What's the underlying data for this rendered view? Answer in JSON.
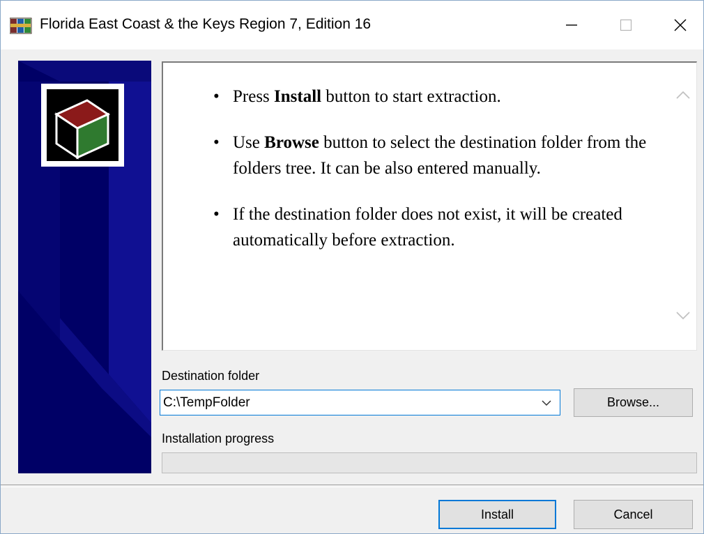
{
  "window": {
    "title": "Florida East Coast & the Keys Region 7, Edition 16",
    "app_icon": "winrar-sfx-icon"
  },
  "titlebar_buttons": {
    "minimize_icon": "minimize-icon",
    "maximize_icon": "maximize-icon",
    "close_icon": "close-icon"
  },
  "banner": {
    "background_color": "#000066",
    "logo_icon": "archive-box-icon"
  },
  "instructions": [
    {
      "pre": "Press ",
      "bold": "Install",
      "post": " button to start extraction."
    },
    {
      "pre": "Use ",
      "bold": "Browse",
      "post": " button to select the destination folder from the folders tree. It can be also entered manually."
    },
    {
      "pre": "If the destination folder does not exist, it will be created automatically before extraction.",
      "bold": "",
      "post": ""
    }
  ],
  "destination": {
    "label": "Destination folder",
    "value": "C:\\TempFolder",
    "browse_label": "Browse..."
  },
  "progress": {
    "label": "Installation progress",
    "value": 0
  },
  "buttons": {
    "install_label": "Install",
    "cancel_label": "Cancel"
  },
  "colors": {
    "accent": "#0078d7",
    "progress_fill": "#06b025"
  }
}
